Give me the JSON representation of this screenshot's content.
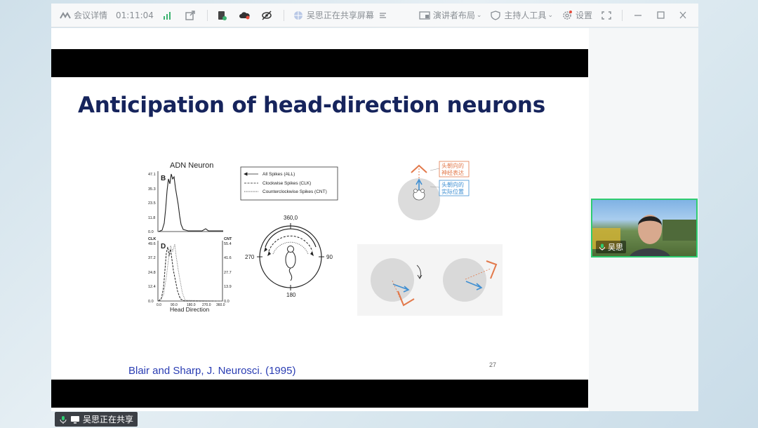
{
  "toolbar": {
    "meeting_details": "会议详情",
    "elapsed_time": "01:11:04",
    "sharing_status": "吴思正在共享屏幕",
    "speaker_layout": "演讲者布局",
    "host_tools": "主持人工具",
    "settings": "设置"
  },
  "slide": {
    "title": "Anticipation of head-direction neurons",
    "citation": "Blair and Sharp, J. Neurosci. (1995)",
    "page_number": "27",
    "figure": {
      "panel_title": "ADN Neuron",
      "label_b": "B",
      "label_d": "D",
      "b_ticks": [
        "47.1",
        "35.3",
        "23.5",
        "11.8",
        "0.0"
      ],
      "clk": "CLK",
      "cnt": "CNT",
      "d_left_ticks": [
        "49.6",
        "37.2",
        "24.8",
        "12.4",
        "0.0"
      ],
      "d_right_ticks": [
        "55.4",
        "41.6",
        "27.7",
        "13.9",
        "0.0"
      ],
      "x_ticks": [
        "0.0",
        "90.0",
        "180.0",
        "270.0",
        "360.0"
      ],
      "x_label": "Head Direction",
      "legend": [
        "All Spikes (ALL)",
        "Clockwise Spikes (CLK)",
        "Counterclockwise Spikes (CNT)"
      ],
      "compass": {
        "top": "360,0",
        "left": "270",
        "right": "90",
        "bottom": "180"
      },
      "annotation_neural": "头朝向的神经表达",
      "annotation_actual": "头朝向的实际位置"
    }
  },
  "participant": {
    "name": "吴思"
  },
  "share_pill": {
    "label": "吴思正在共享"
  },
  "colors": {
    "title": "#16245c",
    "citation": "#2a3db3",
    "speaker_border": "#2ecc71",
    "annotation_orange": "#e2794b",
    "annotation_blue": "#3f8fd2"
  }
}
